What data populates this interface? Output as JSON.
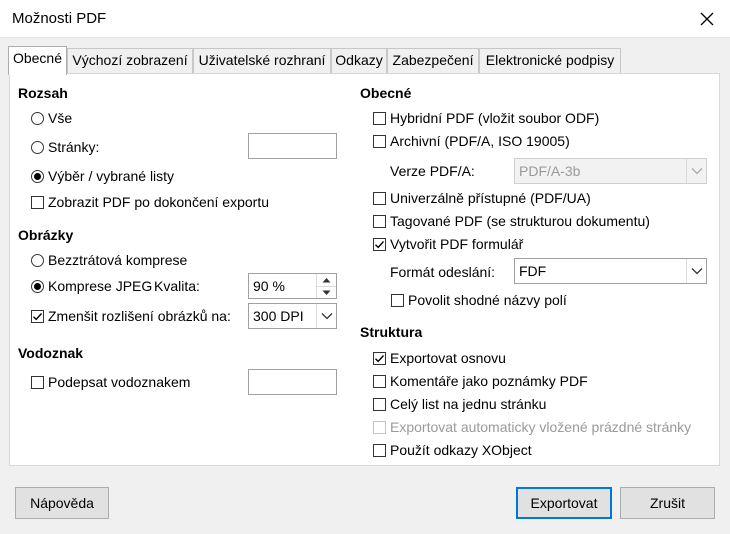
{
  "window": {
    "title": "Možnosti PDF"
  },
  "tabs": [
    {
      "label": "Obecné",
      "active": true
    },
    {
      "label": "Výchozí zobrazení"
    },
    {
      "label": "Uživatelské rozhraní"
    },
    {
      "label": "Odkazy"
    },
    {
      "label": "Zabezpečení"
    },
    {
      "label": "Elektronické podpisy"
    }
  ],
  "left": {
    "range": {
      "heading": "Rozsah",
      "all": {
        "label": "Vše",
        "checked": false
      },
      "pages": {
        "label": "Stránky:",
        "checked": false,
        "value": ""
      },
      "selection": {
        "label": "Výběr / vybrané listy",
        "checked": true
      },
      "view_after": {
        "label": "Zobrazit PDF po dokončení exportu",
        "checked": false
      }
    },
    "images": {
      "heading": "Obrázky",
      "lossless": {
        "label": "Bezztrátová komprese",
        "checked": false
      },
      "jpeg": {
        "label": "Komprese JPEG",
        "checked": true
      },
      "quality_label": "Kvalita:",
      "quality_value": "90 %",
      "reduce": {
        "label": "Zmenšit rozlišení obrázků na:",
        "checked": true
      },
      "dpi_value": "300 DPI"
    },
    "watermark": {
      "heading": "Vodoznak",
      "sign": {
        "label": "Podepsat vodoznakem",
        "checked": false
      },
      "value": ""
    }
  },
  "right": {
    "general": {
      "heading": "Obecné",
      "hybrid": {
        "label": "Hybridní PDF (vložit soubor ODF)",
        "checked": false
      },
      "archive": {
        "label": "Archivní (PDF/A, ISO 19005)",
        "checked": false
      },
      "version_label": "Verze PDF/A:",
      "version_value": "PDF/A-3b",
      "universal": {
        "label": "Univerzálně přístupné (PDF/UA)",
        "checked": false
      },
      "tagged": {
        "label": "Tagované PDF (se strukturou dokumentu)",
        "checked": false
      },
      "form": {
        "label": "Vytvořit PDF formulář",
        "checked": true
      },
      "submit_label": "Formát odeslání:",
      "submit_value": "FDF",
      "same_names": {
        "label": "Povolit shodné názvy polí",
        "checked": false
      }
    },
    "structure": {
      "heading": "Struktura",
      "outline": {
        "label": "Exportovat osnovu",
        "checked": true
      },
      "comments": {
        "label": "Komentáře jako poznámky PDF",
        "checked": false
      },
      "whole_sheet": {
        "label": "Celý list na jednu stránku",
        "checked": false
      },
      "blank_pages": {
        "label": "Exportovat automaticky vložené prázdné stránky",
        "checked": false,
        "disabled": true
      },
      "xobject": {
        "label": "Použít odkazy XObject",
        "checked": false
      }
    }
  },
  "buttons": {
    "help": "Nápověda",
    "export": "Exportovat",
    "cancel": "Zrušit"
  },
  "colors": {
    "accent": "#0078d7",
    "panel": "#ffffff",
    "background": "#f0f0f0"
  }
}
